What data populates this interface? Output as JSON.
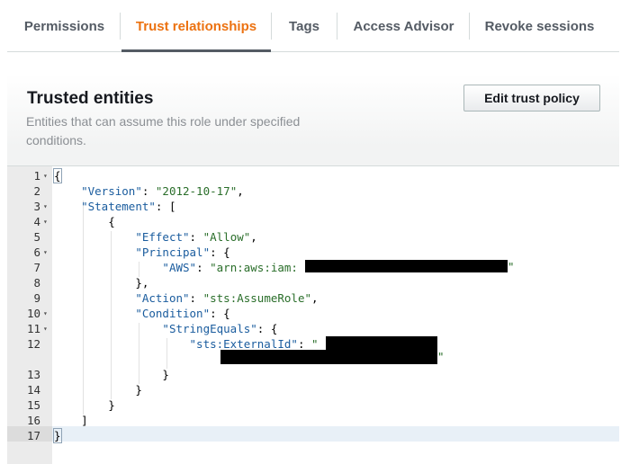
{
  "tabs": [
    {
      "label": "Permissions",
      "active": false
    },
    {
      "label": "Trust relationships",
      "active": true
    },
    {
      "label": "Tags",
      "active": false
    },
    {
      "label": "Access Advisor",
      "active": false
    },
    {
      "label": "Revoke sessions",
      "active": false
    }
  ],
  "panel": {
    "title": "Trusted entities",
    "description": "Entities that can assume this role under specified conditions.",
    "edit_button": "Edit trust policy"
  },
  "colors": {
    "active_tab": "#ec7211",
    "json_key": "#1a5c9e",
    "json_string": "#2a6e2a"
  },
  "editor": {
    "lines": [
      {
        "n": "1",
        "fold": true,
        "html": "<span class=\"p bracket-box\">{</span>"
      },
      {
        "n": "2",
        "fold": false,
        "html": "    <span class=\"k\">\"Version\"</span><span class=\"p\">: </span><span class=\"s\">\"2012-10-17\"</span><span class=\"p\">,</span>"
      },
      {
        "n": "3",
        "fold": true,
        "html": "    <span class=\"k\">\"Statement\"</span><span class=\"p\">: [</span>"
      },
      {
        "n": "4",
        "fold": true,
        "html": "        <span class=\"p\">{</span>"
      },
      {
        "n": "5",
        "fold": false,
        "html": "            <span class=\"k\">\"Effect\"</span><span class=\"p\">: </span><span class=\"s\">\"Allow\"</span><span class=\"p\">,</span>"
      },
      {
        "n": "6",
        "fold": true,
        "html": "            <span class=\"k\">\"Principal\"</span><span class=\"p\">: {</span>"
      },
      {
        "n": "7",
        "fold": false,
        "html": "                <span class=\"k\">\"AWS\"</span><span class=\"p\">: </span><span class=\"s\">\"arn:aws:iam:</span>"
      },
      {
        "n": "8",
        "fold": false,
        "html": "            <span class=\"p\">},</span>"
      },
      {
        "n": "9",
        "fold": false,
        "html": "            <span class=\"k\">\"Action\"</span><span class=\"p\">: </span><span class=\"s\">\"sts:AssumeRole\"</span><span class=\"p\">,</span>"
      },
      {
        "n": "10",
        "fold": true,
        "html": "            <span class=\"k\">\"Condition\"</span><span class=\"p\">: {</span>"
      },
      {
        "n": "11",
        "fold": true,
        "html": "                <span class=\"k\">\"StringEquals\"</span><span class=\"p\">: {</span>"
      },
      {
        "n": "12",
        "fold": false,
        "html": "                    <span class=\"k\">\"sts:ExternalId\"</span><span class=\"p\">: </span><span class=\"s\">\"</span>"
      },
      {
        "n": "",
        "fold": false,
        "html": ""
      },
      {
        "n": "13",
        "fold": false,
        "html": "                <span class=\"p\">}</span>"
      },
      {
        "n": "14",
        "fold": false,
        "html": "            <span class=\"p\">}</span>"
      },
      {
        "n": "15",
        "fold": false,
        "html": "        <span class=\"p\">}</span>"
      },
      {
        "n": "16",
        "fold": false,
        "html": "    <span class=\"p\">]</span>"
      },
      {
        "n": "17",
        "fold": false,
        "html": "<span class=\"p bracket-box\">}</span>"
      }
    ],
    "redacted_closing_quote": "\""
  }
}
